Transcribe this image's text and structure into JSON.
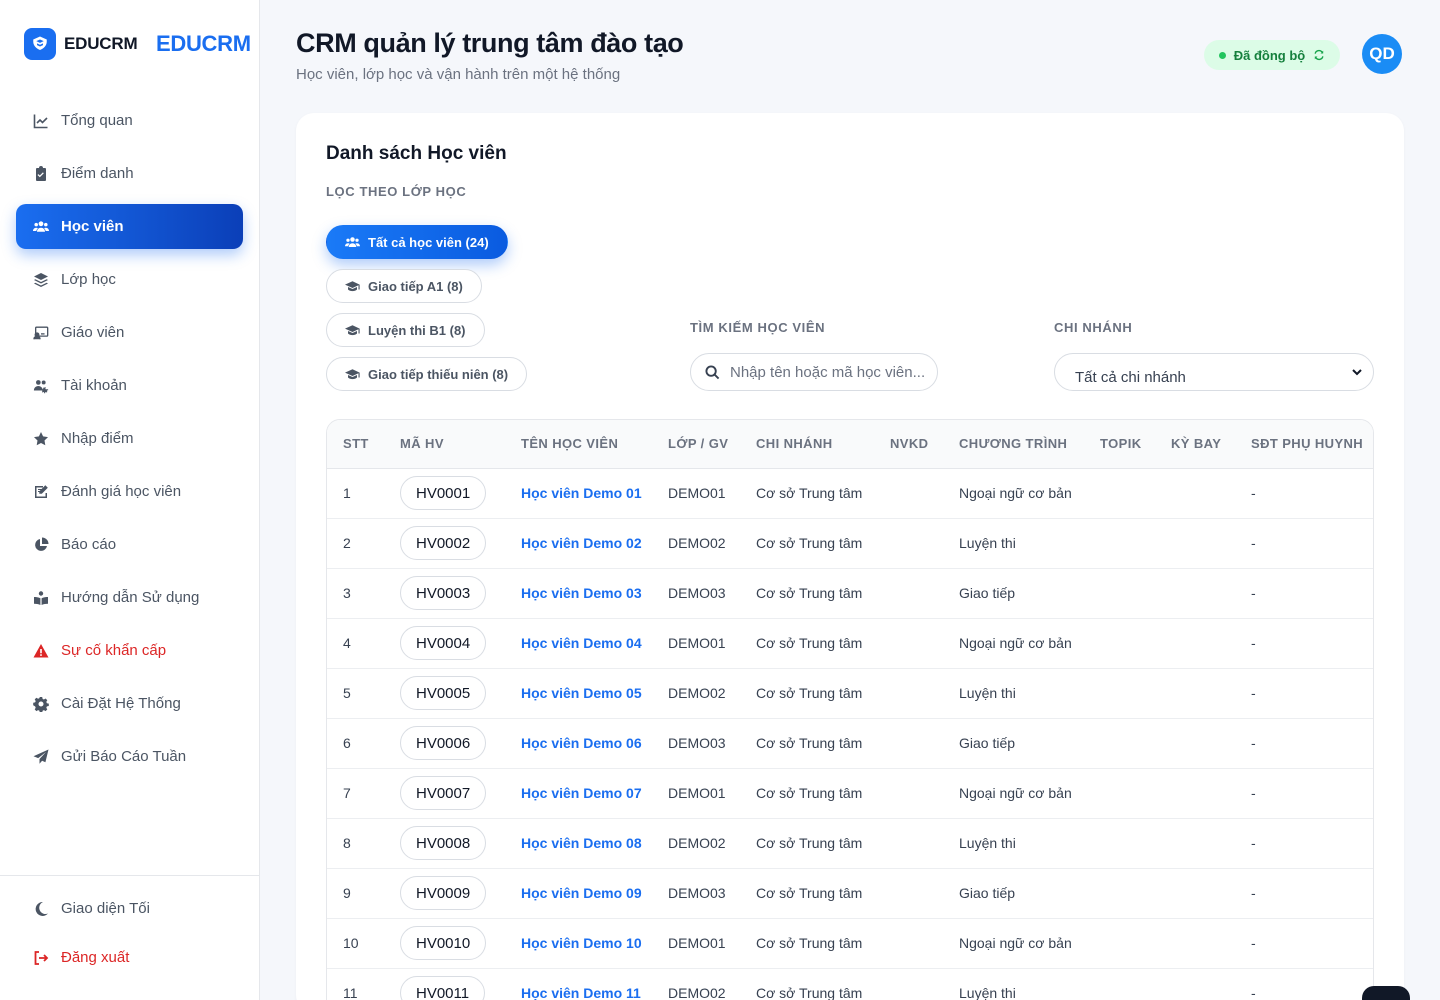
{
  "brand": {
    "name": "EDUCRM",
    "wordmark": "EDUCRM",
    "accent": "#1a6ef0"
  },
  "sidebar": {
    "items": [
      {
        "label": "Tổng quan",
        "icon": "chart-line-icon",
        "active": false
      },
      {
        "label": "Điểm danh",
        "icon": "clipboard-check-icon",
        "active": false
      },
      {
        "label": "Học viên",
        "icon": "users-icon",
        "active": true
      },
      {
        "label": "Lớp học",
        "icon": "layers-icon",
        "active": false
      },
      {
        "label": "Giáo viên",
        "icon": "chalkboard-teacher-icon",
        "active": false
      },
      {
        "label": "Tài khoản",
        "icon": "users-cog-icon",
        "active": false
      },
      {
        "label": "Nhập điểm",
        "icon": "star-icon",
        "active": false
      },
      {
        "label": "Đánh giá học viên",
        "icon": "edit-note-icon",
        "active": false
      },
      {
        "label": "Báo cáo",
        "icon": "pie-chart-icon",
        "active": false
      },
      {
        "label": "Hướng dẫn Sử dụng",
        "icon": "book-user-icon",
        "active": false
      },
      {
        "label": "Sự cố khẩn cấp",
        "icon": "warning-icon",
        "active": false,
        "danger": true
      },
      {
        "label": "Cài Đặt Hệ Thống",
        "icon": "gear-icon",
        "active": false
      },
      {
        "label": "Gửi Báo Cáo Tuần",
        "icon": "paper-plane-icon",
        "active": false
      }
    ],
    "bottom": [
      {
        "label": "Giao diện Tối",
        "icon": "moon-icon"
      },
      {
        "label": "Đăng xuất",
        "icon": "logout-icon",
        "danger": true
      }
    ]
  },
  "header": {
    "title": "CRM quản lý trung tâm đào tạo",
    "subtitle": "Học viên, lớp học và vận hành trên một hệ thống",
    "sync_status": "Đã đồng bộ",
    "avatar_initials": "QD"
  },
  "main": {
    "card_title": "Danh sách Học viên",
    "filter_label": "LỌC THEO LỚP HỌC",
    "filters": [
      {
        "label": "Tất cả học viên (24)",
        "active": true,
        "icon": "users-icon"
      },
      {
        "label": "Giao tiếp A1 (8)",
        "active": false,
        "icon": "graduation-cap-icon"
      },
      {
        "label": "Luyện thi B1 (8)",
        "active": false,
        "icon": "graduation-cap-icon"
      },
      {
        "label": "Giao tiếp thiếu niên (8)",
        "active": false,
        "icon": "graduation-cap-icon"
      }
    ],
    "search": {
      "label": "TÌM KIẾM HỌC VIÊN",
      "placeholder": "Nhập tên hoặc mã học viên..."
    },
    "branch": {
      "label": "CHI NHÁNH",
      "selected": "Tất cả chi nhánh"
    },
    "table": {
      "columns": [
        "STT",
        "MÃ HV",
        "TÊN HỌC VIÊN",
        "LỚP / GV",
        "CHI NHÁNH",
        "NVKD",
        "CHƯƠNG TRÌNH",
        "TOPIK",
        "KỲ BAY",
        "SĐT PHỤ HUYNH"
      ],
      "rows": [
        {
          "stt": "1",
          "code": "HV0001",
          "name": "Học viên Demo 01",
          "class": "DEMO01",
          "branch": "Cơ sở Trung tâm",
          "nvkd": "",
          "program": "Ngoại ngữ cơ bản",
          "topik": "",
          "ky_bay": "",
          "parent_phone": "-"
        },
        {
          "stt": "2",
          "code": "HV0002",
          "name": "Học viên Demo 02",
          "class": "DEMO02",
          "branch": "Cơ sở Trung tâm",
          "nvkd": "",
          "program": "Luyện thi",
          "topik": "",
          "ky_bay": "",
          "parent_phone": "-"
        },
        {
          "stt": "3",
          "code": "HV0003",
          "name": "Học viên Demo 03",
          "class": "DEMO03",
          "branch": "Cơ sở Trung tâm",
          "nvkd": "",
          "program": "Giao tiếp",
          "topik": "",
          "ky_bay": "",
          "parent_phone": "-"
        },
        {
          "stt": "4",
          "code": "HV0004",
          "name": "Học viên Demo 04",
          "class": "DEMO01",
          "branch": "Cơ sở Trung tâm",
          "nvkd": "",
          "program": "Ngoại ngữ cơ bản",
          "topik": "",
          "ky_bay": "",
          "parent_phone": "-"
        },
        {
          "stt": "5",
          "code": "HV0005",
          "name": "Học viên Demo 05",
          "class": "DEMO02",
          "branch": "Cơ sở Trung tâm",
          "nvkd": "",
          "program": "Luyện thi",
          "topik": "",
          "ky_bay": "",
          "parent_phone": "-"
        },
        {
          "stt": "6",
          "code": "HV0006",
          "name": "Học viên Demo 06",
          "class": "DEMO03",
          "branch": "Cơ sở Trung tâm",
          "nvkd": "",
          "program": "Giao tiếp",
          "topik": "",
          "ky_bay": "",
          "parent_phone": "-"
        },
        {
          "stt": "7",
          "code": "HV0007",
          "name": "Học viên Demo 07",
          "class": "DEMO01",
          "branch": "Cơ sở Trung tâm",
          "nvkd": "",
          "program": "Ngoại ngữ cơ bản",
          "topik": "",
          "ky_bay": "",
          "parent_phone": "-"
        },
        {
          "stt": "8",
          "code": "HV0008",
          "name": "Học viên Demo 08",
          "class": "DEMO02",
          "branch": "Cơ sở Trung tâm",
          "nvkd": "",
          "program": "Luyện thi",
          "topik": "",
          "ky_bay": "",
          "parent_phone": "-"
        },
        {
          "stt": "9",
          "code": "HV0009",
          "name": "Học viên Demo 09",
          "class": "DEMO03",
          "branch": "Cơ sở Trung tâm",
          "nvkd": "",
          "program": "Giao tiếp",
          "topik": "",
          "ky_bay": "",
          "parent_phone": "-"
        },
        {
          "stt": "10",
          "code": "HV0010",
          "name": "Học viên Demo 10",
          "class": "DEMO01",
          "branch": "Cơ sở Trung tâm",
          "nvkd": "",
          "program": "Ngoại ngữ cơ bản",
          "topik": "",
          "ky_bay": "",
          "parent_phone": "-"
        },
        {
          "stt": "11",
          "code": "HV0011",
          "name": "Học viên Demo 11",
          "class": "DEMO02",
          "branch": "Cơ sở Trung tâm",
          "nvkd": "",
          "program": "Luyện thi",
          "topik": "",
          "ky_bay": "",
          "parent_phone": "-"
        }
      ]
    }
  }
}
